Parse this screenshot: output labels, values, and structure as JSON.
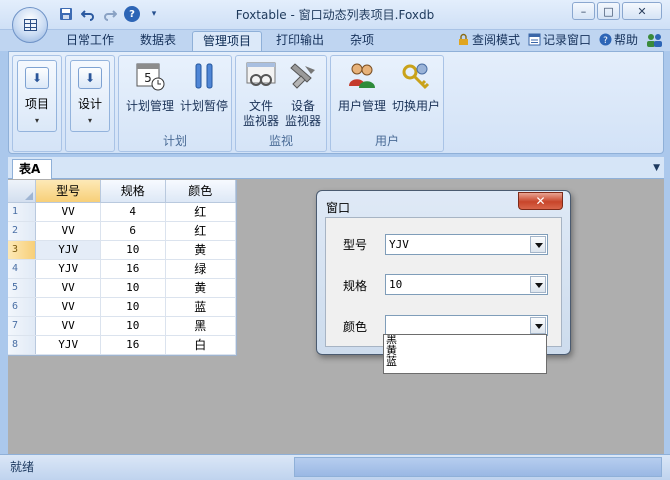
{
  "window": {
    "title": "Foxtable - 窗口动态列表项目.Foxdb",
    "min_label": "–",
    "max_label": "□",
    "close_label": "✕"
  },
  "quick_access": {
    "save_icon": "save-icon",
    "undo_icon": "undo-icon",
    "redo_icon": "redo-icon",
    "help_label": "?"
  },
  "ribbon_tabs": [
    {
      "label": "日常工作"
    },
    {
      "label": "数据表"
    },
    {
      "label": "管理项目",
      "active": true
    },
    {
      "label": "打印输出"
    },
    {
      "label": "杂项"
    }
  ],
  "right_links": {
    "query_mode": "查阅模式",
    "record_window": "记录窗口",
    "help": "帮助"
  },
  "ribbon": {
    "project_label": "项目",
    "design_label": "设计",
    "plan_manage": "计划管理",
    "plan_pause": "计划暂停",
    "plan_group": "计划",
    "file_monitor_line1": "文件",
    "file_monitor_line2": "监视器",
    "device_monitor_line1": "设备",
    "device_monitor_line2": "监视器",
    "monitor_group": "监视",
    "user_manage": "用户管理",
    "switch_user": "切换用户",
    "user_group": "用户"
  },
  "doc_tab": {
    "label": "表A"
  },
  "table": {
    "columns": [
      "型号",
      "规格",
      "颜色"
    ],
    "rows": [
      {
        "n": "1",
        "model": "VV",
        "spec": "4",
        "color": "红"
      },
      {
        "n": "2",
        "model": "VV",
        "spec": "6",
        "color": "红"
      },
      {
        "n": "3",
        "model": "YJV",
        "spec": "10",
        "color": "黄"
      },
      {
        "n": "4",
        "model": "YJV",
        "spec": "16",
        "color": "绿"
      },
      {
        "n": "5",
        "model": "VV",
        "spec": "10",
        "color": "黄"
      },
      {
        "n": "6",
        "model": "VV",
        "spec": "10",
        "color": "蓝"
      },
      {
        "n": "7",
        "model": "VV",
        "spec": "10",
        "color": "黑"
      },
      {
        "n": "8",
        "model": "YJV",
        "spec": "16",
        "color": "白"
      }
    ]
  },
  "dialog": {
    "title": "窗口",
    "close_label": "✕",
    "model_label": "型号",
    "model_value": "YJV",
    "spec_label": "规格",
    "spec_value": "10",
    "color_label": "颜色",
    "color_value": "",
    "color_options": [
      "黑",
      "黄",
      "蓝"
    ]
  },
  "status": {
    "text": "就绪"
  }
}
